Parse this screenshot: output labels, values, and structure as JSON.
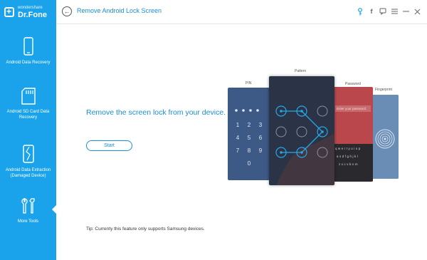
{
  "app": {
    "brand_small": "wondershare",
    "brand_big": "Dr.Fone"
  },
  "header": {
    "title": "Remove Android Lock Screen",
    "icons": [
      "back-icon",
      "key-icon",
      "facebook-icon",
      "chat-icon",
      "menu-icon",
      "minimize-icon",
      "close-icon"
    ]
  },
  "sidebar": {
    "items": [
      {
        "label": "Android Data Recovery",
        "icon": "phone-icon"
      },
      {
        "label": "Android SD Card Data Recovery",
        "icon": "sd-card-icon"
      },
      {
        "label": "Android Data Extraction (Damaged Device)",
        "icon": "broken-phone-icon"
      },
      {
        "label": "More Tools",
        "icon": "tools-icon"
      }
    ]
  },
  "main": {
    "heading": "Remove the screen lock from your device.",
    "start_label": "Start",
    "tip": "Tip: Currenty this feature only supports Samsung devices."
  },
  "illustration": {
    "labels": {
      "pin": "PIN",
      "pattern": "Pattern",
      "password": "Password",
      "fingerprint": "Fingerprint"
    },
    "pin_keys": [
      "1",
      "2",
      "3",
      "4",
      "5",
      "6",
      "7",
      "8",
      "9",
      "0"
    ],
    "password_placeholder": "Enter your password",
    "keyboard_rows": [
      "qwertyuiop",
      "asdfghjkl",
      "zxcvbnm"
    ]
  },
  "colors": {
    "sidebar": "#1aa3ea",
    "accent": "#1a8fd6",
    "phone_dark": "#2b3446",
    "pin_blue": "#3d5a86",
    "password_red": "#b9474c",
    "fingerprint_blue": "#5b7fa8"
  }
}
